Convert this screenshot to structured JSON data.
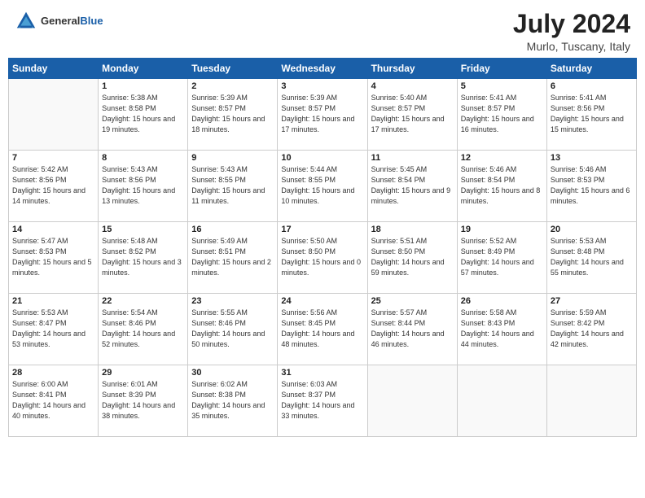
{
  "header": {
    "logo": {
      "general": "General",
      "blue": "Blue"
    },
    "title": "July 2024",
    "location": "Murlo, Tuscany, Italy"
  },
  "weekdays": [
    "Sunday",
    "Monday",
    "Tuesday",
    "Wednesday",
    "Thursday",
    "Friday",
    "Saturday"
  ],
  "weeks": [
    [
      {
        "day": null
      },
      {
        "day": 1,
        "sunrise": "5:38 AM",
        "sunset": "8:58 PM",
        "daylight": "15 hours and 19 minutes."
      },
      {
        "day": 2,
        "sunrise": "5:39 AM",
        "sunset": "8:57 PM",
        "daylight": "15 hours and 18 minutes."
      },
      {
        "day": 3,
        "sunrise": "5:39 AM",
        "sunset": "8:57 PM",
        "daylight": "15 hours and 17 minutes."
      },
      {
        "day": 4,
        "sunrise": "5:40 AM",
        "sunset": "8:57 PM",
        "daylight": "15 hours and 17 minutes."
      },
      {
        "day": 5,
        "sunrise": "5:41 AM",
        "sunset": "8:57 PM",
        "daylight": "15 hours and 16 minutes."
      },
      {
        "day": 6,
        "sunrise": "5:41 AM",
        "sunset": "8:56 PM",
        "daylight": "15 hours and 15 minutes."
      }
    ],
    [
      {
        "day": 7,
        "sunrise": "5:42 AM",
        "sunset": "8:56 PM",
        "daylight": "15 hours and 14 minutes."
      },
      {
        "day": 8,
        "sunrise": "5:43 AM",
        "sunset": "8:56 PM",
        "daylight": "15 hours and 13 minutes."
      },
      {
        "day": 9,
        "sunrise": "5:43 AM",
        "sunset": "8:55 PM",
        "daylight": "15 hours and 11 minutes."
      },
      {
        "day": 10,
        "sunrise": "5:44 AM",
        "sunset": "8:55 PM",
        "daylight": "15 hours and 10 minutes."
      },
      {
        "day": 11,
        "sunrise": "5:45 AM",
        "sunset": "8:54 PM",
        "daylight": "15 hours and 9 minutes."
      },
      {
        "day": 12,
        "sunrise": "5:46 AM",
        "sunset": "8:54 PM",
        "daylight": "15 hours and 8 minutes."
      },
      {
        "day": 13,
        "sunrise": "5:46 AM",
        "sunset": "8:53 PM",
        "daylight": "15 hours and 6 minutes."
      }
    ],
    [
      {
        "day": 14,
        "sunrise": "5:47 AM",
        "sunset": "8:53 PM",
        "daylight": "15 hours and 5 minutes."
      },
      {
        "day": 15,
        "sunrise": "5:48 AM",
        "sunset": "8:52 PM",
        "daylight": "15 hours and 3 minutes."
      },
      {
        "day": 16,
        "sunrise": "5:49 AM",
        "sunset": "8:51 PM",
        "daylight": "15 hours and 2 minutes."
      },
      {
        "day": 17,
        "sunrise": "5:50 AM",
        "sunset": "8:50 PM",
        "daylight": "15 hours and 0 minutes."
      },
      {
        "day": 18,
        "sunrise": "5:51 AM",
        "sunset": "8:50 PM",
        "daylight": "14 hours and 59 minutes."
      },
      {
        "day": 19,
        "sunrise": "5:52 AM",
        "sunset": "8:49 PM",
        "daylight": "14 hours and 57 minutes."
      },
      {
        "day": 20,
        "sunrise": "5:53 AM",
        "sunset": "8:48 PM",
        "daylight": "14 hours and 55 minutes."
      }
    ],
    [
      {
        "day": 21,
        "sunrise": "5:53 AM",
        "sunset": "8:47 PM",
        "daylight": "14 hours and 53 minutes."
      },
      {
        "day": 22,
        "sunrise": "5:54 AM",
        "sunset": "8:46 PM",
        "daylight": "14 hours and 52 minutes."
      },
      {
        "day": 23,
        "sunrise": "5:55 AM",
        "sunset": "8:46 PM",
        "daylight": "14 hours and 50 minutes."
      },
      {
        "day": 24,
        "sunrise": "5:56 AM",
        "sunset": "8:45 PM",
        "daylight": "14 hours and 48 minutes."
      },
      {
        "day": 25,
        "sunrise": "5:57 AM",
        "sunset": "8:44 PM",
        "daylight": "14 hours and 46 minutes."
      },
      {
        "day": 26,
        "sunrise": "5:58 AM",
        "sunset": "8:43 PM",
        "daylight": "14 hours and 44 minutes."
      },
      {
        "day": 27,
        "sunrise": "5:59 AM",
        "sunset": "8:42 PM",
        "daylight": "14 hours and 42 minutes."
      }
    ],
    [
      {
        "day": 28,
        "sunrise": "6:00 AM",
        "sunset": "8:41 PM",
        "daylight": "14 hours and 40 minutes."
      },
      {
        "day": 29,
        "sunrise": "6:01 AM",
        "sunset": "8:39 PM",
        "daylight": "14 hours and 38 minutes."
      },
      {
        "day": 30,
        "sunrise": "6:02 AM",
        "sunset": "8:38 PM",
        "daylight": "14 hours and 35 minutes."
      },
      {
        "day": 31,
        "sunrise": "6:03 AM",
        "sunset": "8:37 PM",
        "daylight": "14 hours and 33 minutes."
      },
      {
        "day": null
      },
      {
        "day": null
      },
      {
        "day": null
      }
    ]
  ]
}
